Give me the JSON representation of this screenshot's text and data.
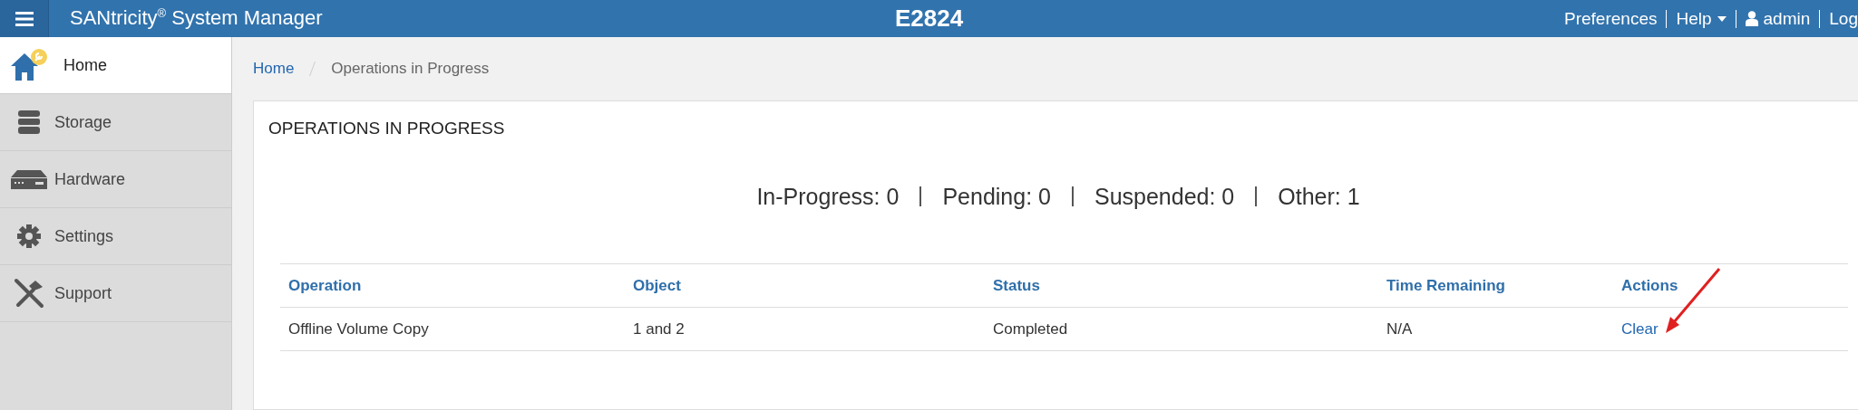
{
  "header": {
    "app_title": "SANtricity$^{®}$ System Manager",
    "system_name": "E2824",
    "links": [
      {
        "label": "Preferences",
        "kind": "plain"
      },
      {
        "label": "Help",
        "kind": "dropdown"
      },
      {
        "label": "admin",
        "kind": "user"
      },
      {
        "label": "Log",
        "kind": "plain"
      }
    ]
  },
  "sidebar": {
    "items": [
      {
        "label": "Home",
        "selected": true
      },
      {
        "label": "Storage",
        "selected": false
      },
      {
        "label": "Hardware",
        "selected": false
      },
      {
        "label": "Settings",
        "selected": false
      },
      {
        "label": "Support",
        "selected": false
      }
    ]
  },
  "breadcrumb": [
    {
      "label": "Home",
      "kind": "link"
    },
    {
      "label": "Operations in Progress",
      "kind": "current"
    }
  ],
  "card": {
    "title": "OPERATIONS IN PROGRESS",
    "summary": [
      "In-Progress: 0",
      "Pending: 0",
      "Suspended: 0",
      "Other: 1"
    ],
    "table": {
      "columns": [
        "Operation",
        "Object",
        "Status",
        "Time Remaining",
        "Actions"
      ],
      "rows": [
        {
          "operation": "Offline Volume Copy",
          "object": "1 and 2",
          "status": "Completed",
          "time_remaining": "N/A",
          "action": "Clear"
        }
      ]
    }
  }
}
